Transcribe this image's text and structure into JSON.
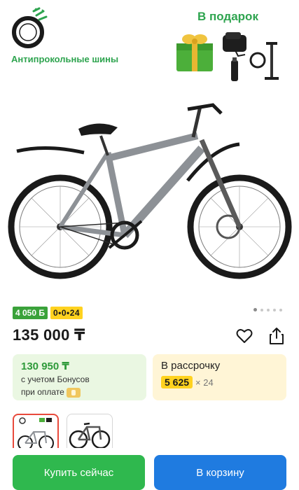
{
  "promo": {
    "tires_label": "Антипрокольные шины",
    "gift_title": "В подарок"
  },
  "badges": {
    "bonus_points": "4 050 Б",
    "installment_tag": "0•0•24"
  },
  "gallery": {
    "dot_count": 5,
    "active_index": 0
  },
  "product": {
    "price": "135 000 ₸"
  },
  "bonus_card": {
    "amount": "130 950 ₸",
    "line1": "с учетом Бонусов",
    "line2": "при оплате"
  },
  "credit_card": {
    "title": "В рассрочку",
    "amount": "5 625",
    "months": "× 24"
  },
  "actions": {
    "buy_now": "Купить сейчас",
    "add_to_cart": "В корзину"
  },
  "colors": {
    "accent_green": "#2fb84e",
    "accent_blue": "#1f7be0",
    "bonus_yellow": "#ffd21f"
  }
}
